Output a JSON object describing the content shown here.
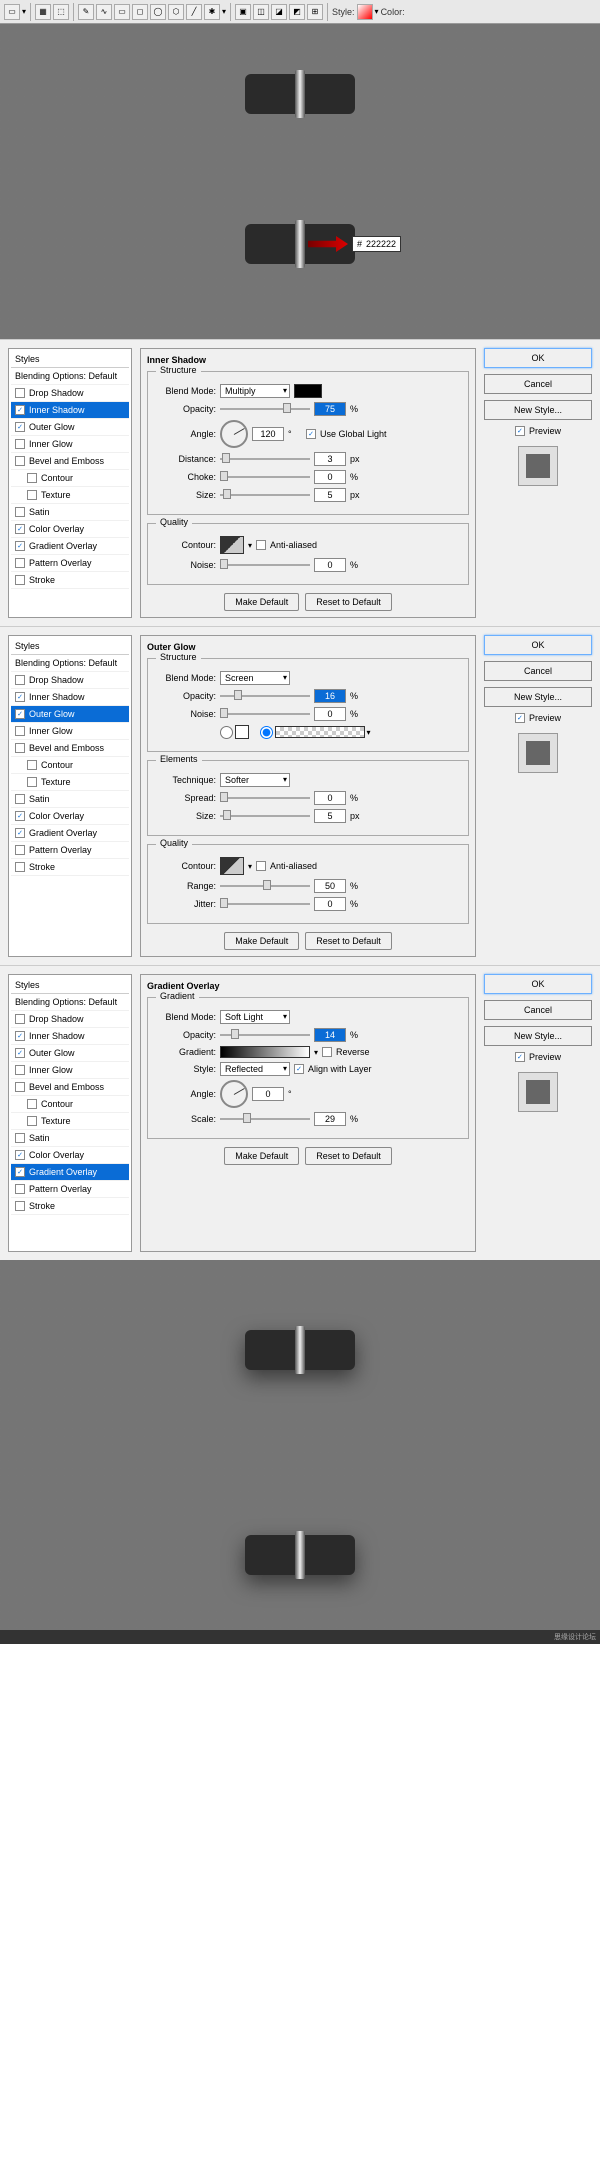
{
  "toolbar": {
    "style_label": "Style:",
    "color_label": "Color:"
  },
  "hex_hint": {
    "hash": "#",
    "value": "222222"
  },
  "styles_list": {
    "header": "Styles",
    "blending": "Blending Options: Default",
    "drop_shadow": "Drop Shadow",
    "inner_shadow": "Inner Shadow",
    "outer_glow": "Outer Glow",
    "inner_glow": "Inner Glow",
    "bevel": "Bevel and Emboss",
    "contour": "Contour",
    "texture": "Texture",
    "satin": "Satin",
    "color_overlay": "Color Overlay",
    "gradient_overlay": "Gradient Overlay",
    "pattern_overlay": "Pattern Overlay",
    "stroke": "Stroke"
  },
  "inner_shadow": {
    "title": "Inner Shadow",
    "structure": "Structure",
    "blend_mode_lbl": "Blend Mode:",
    "blend_mode": "Multiply",
    "opacity_lbl": "Opacity:",
    "opacity": "75",
    "pct": "%",
    "angle_lbl": "Angle:",
    "angle": "120",
    "deg": "°",
    "global_light": "Use Global Light",
    "dist_lbl": "Distance:",
    "dist": "3",
    "px": "px",
    "choke_lbl": "Choke:",
    "choke": "0",
    "size_lbl": "Size:",
    "size": "5",
    "quality": "Quality",
    "contour_lbl": "Contour:",
    "aa": "Anti-aliased",
    "noise_lbl": "Noise:",
    "noise": "0"
  },
  "outer_glow": {
    "title": "Outer Glow",
    "structure": "Structure",
    "blend_mode_lbl": "Blend Mode:",
    "blend_mode": "Screen",
    "opacity_lbl": "Opacity:",
    "opacity": "16",
    "pct": "%",
    "noise_lbl": "Noise:",
    "noise": "0",
    "elements": "Elements",
    "technique_lbl": "Technique:",
    "technique": "Softer",
    "spread_lbl": "Spread:",
    "spread": "0",
    "size_lbl": "Size:",
    "size": "5",
    "px": "px",
    "quality": "Quality",
    "contour_lbl": "Contour:",
    "aa": "Anti-aliased",
    "range_lbl": "Range:",
    "range": "50",
    "jitter_lbl": "Jitter:",
    "jitter": "0"
  },
  "gradient_overlay": {
    "title": "Gradient Overlay",
    "gradient_sec": "Gradient",
    "blend_mode_lbl": "Blend Mode:",
    "blend_mode": "Soft Light",
    "opacity_lbl": "Opacity:",
    "opacity": "14",
    "pct": "%",
    "gradient_lbl": "Gradient:",
    "reverse": "Reverse",
    "style_lbl": "Style:",
    "style": "Reflected",
    "align": "Align with Layer",
    "angle_lbl": "Angle:",
    "angle": "0",
    "deg": "°",
    "scale_lbl": "Scale:",
    "scale": "29"
  },
  "buttons": {
    "ok": "OK",
    "cancel": "Cancel",
    "new_style": "New Style...",
    "preview": "Preview",
    "make_default": "Make Default",
    "reset": "Reset to Default"
  }
}
